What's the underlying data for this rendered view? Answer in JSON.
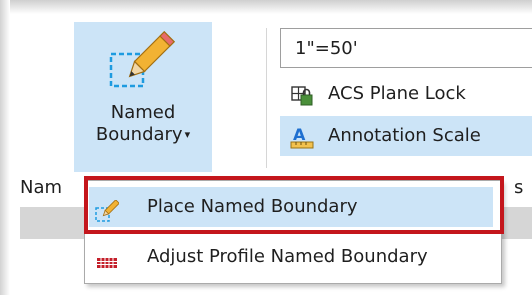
{
  "ribbon": {
    "named_boundary": {
      "label_line1": "Named",
      "label_line2": "Boundary",
      "caret": "▾",
      "icon": "pencil-dashed-box-icon"
    },
    "scale_value": "1\"=50'",
    "acs_plane_lock": {
      "label": "ACS Plane Lock",
      "icon": "acs-plane-lock-icon"
    },
    "annotation_scale": {
      "label": "Annotation Scale",
      "icon": "annotation-scale-icon"
    },
    "group_label_partial": "Nam",
    "cutoff_right": "s"
  },
  "dropdown": {
    "items": [
      {
        "label": "Place Named Boundary",
        "icon": "pencil-dashed-box-icon",
        "highlighted": true
      },
      {
        "label": "Adjust Profile Named Boundary",
        "icon": "profile-grid-icon",
        "highlighted": false
      }
    ]
  },
  "colors": {
    "selection_blue": "#cce4f7",
    "highlight_frame_red": "#c4161c",
    "icon_blue": "#1e9be0"
  }
}
